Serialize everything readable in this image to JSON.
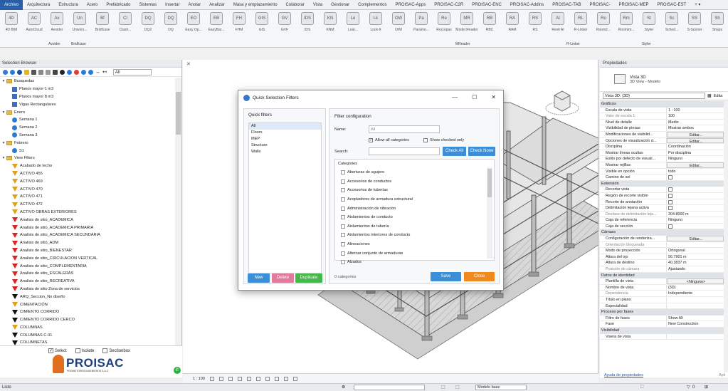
{
  "menubar": {
    "items": [
      "Archivo",
      "Arquitectura",
      "Estructura",
      "Acero",
      "Prefabricado",
      "Sistemas",
      "Insertar",
      "Anotar",
      "Analizar",
      "Masa y emplazamiento",
      "Colaborar",
      "Vista",
      "Gestionar",
      "Complementos",
      "PROISAC-Apps",
      "PROISAC-C2R",
      "PROISAC-ENC",
      "PROISAC-Addins",
      "PROISAC-TAB",
      "PROISAC-",
      "PROISAC-MEP",
      "PROISAC-EST"
    ],
    "extra": "+ ▾"
  },
  "ribbon": {
    "buttons": [
      {
        "label": "4D BIM",
        "icon": "4D"
      },
      {
        "label": "AutoCloud",
        "icon": "AC"
      },
      {
        "label": "Avoider",
        "icon": "Av"
      },
      {
        "label": "Univers...",
        "icon": "Un"
      },
      {
        "label": "Bridfcase",
        "icon": "Bf"
      },
      {
        "label": "Clash...",
        "icon": "Cl"
      },
      {
        "label": "DQ2",
        "icon": "DQ"
      },
      {
        "label": "DQ",
        "icon": "DQ"
      },
      {
        "label": "Easy Op...",
        "icon": "EO"
      },
      {
        "label": "EasyBar...",
        "icon": "EB"
      },
      {
        "label": "FHM",
        "icon": "FH"
      },
      {
        "label": "GIS",
        "icon": "GIS"
      },
      {
        "label": "GVF",
        "icon": "GV"
      },
      {
        "label": "IDS",
        "icon": "IDS"
      },
      {
        "label": "KNM",
        "icon": "KN"
      },
      {
        "label": "Lear...",
        "icon": "Le"
      },
      {
        "label": "Lock-It",
        "icon": "Lk"
      },
      {
        "label": "OWI",
        "icon": "OW"
      },
      {
        "label": "Parame...",
        "icon": "Pa"
      },
      {
        "label": "Recorpas",
        "icon": "Re"
      },
      {
        "label": "Model Reader",
        "icon": "MR"
      },
      {
        "label": "RBC",
        "icon": "RB"
      },
      {
        "label": "RAM",
        "icon": "RA"
      },
      {
        "label": "RS",
        "icon": "RS"
      },
      {
        "label": "Revit AI",
        "icon": "AI"
      },
      {
        "label": "R-Linker",
        "icon": "RL"
      },
      {
        "label": "Room2...",
        "icon": "Ro"
      },
      {
        "label": "Roomint...",
        "icon": "Rm"
      },
      {
        "label": "Styler",
        "icon": "St"
      },
      {
        "label": "Sched...",
        "icon": "Sc"
      },
      {
        "label": "S-Sooner",
        "icon": "SS"
      },
      {
        "label": "Shaps",
        "icon": "Sh"
      }
    ],
    "groups": [
      {
        "label": "Avoider"
      },
      {
        "label": "Bridfcase"
      },
      {
        "label": "MReader"
      },
      {
        "label": "R-Linker"
      },
      {
        "label": "Styler"
      }
    ]
  },
  "selection_browser": {
    "title": "Selection Browser",
    "filter_select": "All",
    "tree": [
      {
        "level": 0,
        "type": "folder",
        "label": "Busquedas",
        "twisty": "▼"
      },
      {
        "level": 1,
        "type": "blue",
        "label": "Planos mayor 1 m3"
      },
      {
        "level": 1,
        "type": "blue",
        "label": "Planos mayor 8 m3"
      },
      {
        "level": 1,
        "type": "blue",
        "label": "Vigas Rectangulares"
      },
      {
        "level": 0,
        "type": "folder",
        "label": "Enero",
        "twisty": "▼"
      },
      {
        "level": 1,
        "type": "circle",
        "label": "Semana 1"
      },
      {
        "level": 1,
        "type": "circle",
        "label": "Semana 2"
      },
      {
        "level": 1,
        "type": "circle",
        "label": "Semana 3"
      },
      {
        "level": 0,
        "type": "folder",
        "label": "Febrero",
        "twisty": "▼"
      },
      {
        "level": 1,
        "type": "circle",
        "label": "S1"
      },
      {
        "level": 0,
        "type": "folder",
        "label": "View Filters",
        "twisty": "▼"
      },
      {
        "level": 1,
        "type": "yellow",
        "label": "Acabado de techo"
      },
      {
        "level": 1,
        "type": "yellow",
        "label": "ACTIVO 455"
      },
      {
        "level": 1,
        "type": "yellow",
        "label": "ACTIVO 469"
      },
      {
        "level": 1,
        "type": "yellow",
        "label": "ACTIVO 470"
      },
      {
        "level": 1,
        "type": "yellow",
        "label": "ACTIVO 471"
      },
      {
        "level": 1,
        "type": "yellow",
        "label": "ACTIVO 472"
      },
      {
        "level": 1,
        "type": "yellow",
        "label": "ACTIVO OBRAS EXTERIORES"
      },
      {
        "level": 1,
        "type": "red",
        "label": "Analisis de sitio_ACADEMICA"
      },
      {
        "level": 1,
        "type": "red",
        "label": "Analisis de sitio_ACADEMICA PRIMARIA"
      },
      {
        "level": 1,
        "type": "red",
        "label": "Analisis de sitio_ACADEMICA SECUNDARIA"
      },
      {
        "level": 1,
        "type": "red",
        "label": "Analisis de sitio_ADM"
      },
      {
        "level": 1,
        "type": "red",
        "label": "Analisis de sitio_BIENESTAR"
      },
      {
        "level": 1,
        "type": "red",
        "label": "Analisis de sitio_CIRCULACION VERTICAL"
      },
      {
        "level": 1,
        "type": "red",
        "label": "Analisis de sitio_COMPLEMENTARIA"
      },
      {
        "level": 1,
        "type": "red",
        "label": "Analisis de sitio_ESCALERAS"
      },
      {
        "level": 1,
        "type": "red",
        "label": "Analisis de sitio_RECREATIVA"
      },
      {
        "level": 1,
        "type": "red",
        "label": "Analisis de sitio Zona de servicios"
      },
      {
        "level": 1,
        "type": "black",
        "label": "ARQ_Seccion_No diseño"
      },
      {
        "level": 1,
        "type": "yellow",
        "label": "CIMENTACIÓN"
      },
      {
        "level": 1,
        "type": "black",
        "label": "CIMIENTO CORRIDO"
      },
      {
        "level": 1,
        "type": "black",
        "label": "CIMIENTO CORRIDO CERCO"
      },
      {
        "level": 1,
        "type": "yellow",
        "label": "COLUMNAS"
      },
      {
        "level": 1,
        "type": "black",
        "label": "COLUMNAS C-01"
      },
      {
        "level": 1,
        "type": "black",
        "label": "COLUMNETAS"
      }
    ],
    "footer": {
      "select": "Select",
      "isolate": "Isolate",
      "sectionbox": "Sectionbox"
    },
    "logo": {
      "text": "PROISAC",
      "sub": "PROMOTORES INGENIEROS S.A.C."
    }
  },
  "dialog": {
    "title": "Quick Selection Filters",
    "quick_filters_title": "Quick filters",
    "quick_filters": [
      "All",
      "Floors",
      "MEP",
      "Structure",
      "Walls"
    ],
    "new_label": "New",
    "delete_label": "Delete",
    "duplicate_label": "Duplicate",
    "filter_config_title": "Filter configuration",
    "name_label": "Name:",
    "name_value": "All",
    "allow_all_label": "Allow all categories",
    "show_checked_label": "Show checked only",
    "search_label": "Search:",
    "check_all_label": "Check All",
    "check_none_label": "Check None",
    "categories_header": "Categories",
    "categories": [
      "Aberturas de agujero",
      "Accesorios de conductos",
      "Accesorios de tuberías",
      "Acopladores de armadura estructural",
      "Administración de vibración",
      "Aislamientos de conducto",
      "Aislamientos de tubería",
      "Aislamientos interiores de conducto",
      "Alineaciones",
      "Alternar conjunto de armaduras",
      "Alzados"
    ],
    "categories_count": "0 categories",
    "save_label": "Save",
    "close_label": "Close"
  },
  "properties": {
    "title": "Propiedades",
    "type_line1": "Vista 3D",
    "type_line2": "3D View - Modelo",
    "view_selector": "Vista 3D: {3D}",
    "edit_type": "Edita",
    "rows": [
      {
        "section": "Gráficos"
      },
      {
        "k": "Escala de vista",
        "v": "1 : 100"
      },
      {
        "k": "Valor de escala   1:",
        "v": "100",
        "dis": true
      },
      {
        "k": "Nivel de detalle",
        "v": "Medio"
      },
      {
        "k": "Visibilidad de piezas",
        "v": "Mostrar ambos"
      },
      {
        "k": "Modificaciones de visibilid...",
        "v": "Editar...",
        "btn": true
      },
      {
        "k": "Opciones de visualización d...",
        "v": "Editar...",
        "btn": true
      },
      {
        "k": "Disciplina",
        "v": "Coordinación"
      },
      {
        "k": "Mostrar líneas ocultas",
        "v": "Por disciplina"
      },
      {
        "k": "Estilo por defecto de visuali...",
        "v": "Ninguno"
      },
      {
        "k": "Mostrar rejillas",
        "v": "Editar...",
        "btn": true
      },
      {
        "k": "Visible en opción",
        "v": "todo"
      },
      {
        "k": "Camino de sol",
        "cb": true
      },
      {
        "section": "Extensión"
      },
      {
        "k": "Recortar vista",
        "cb": true
      },
      {
        "k": "Región de recorte visible",
        "cb": true
      },
      {
        "k": "Recorte de anotación",
        "cb": true
      },
      {
        "k": "Delimitación lejana activa",
        "cb": true
      },
      {
        "k": "Desfase de delimitación leja...",
        "v": "304.8000 m",
        "dis": true
      },
      {
        "k": "Caja de referencia",
        "v": "Ninguno"
      },
      {
        "k": "Caja de sección",
        "cb": true
      },
      {
        "section": "Cámara"
      },
      {
        "k": "Configuración de renderiza...",
        "v": "Editar...",
        "btn": true
      },
      {
        "k": "Orientación bloqueada",
        "dis": true
      },
      {
        "k": "Modo de proyección",
        "v": "Ortogonal"
      },
      {
        "k": "Altura del ojo",
        "v": "56.7901 m"
      },
      {
        "k": "Altura de destino",
        "v": "40.3837 m"
      },
      {
        "k": "Posición de cámara",
        "v": "Ajustando",
        "dis": true
      },
      {
        "section": "Datos de identidad"
      },
      {
        "k": "Plantilla de vista",
        "v": "<Ninguno>",
        "btn": true
      },
      {
        "k": "Nombre de vista",
        "v": "{3D}"
      },
      {
        "k": "Dependencia",
        "v": "Independiente",
        "dis": true
      },
      {
        "k": "Título en plano",
        "v": ""
      },
      {
        "k": "Especialidad",
        "v": ""
      },
      {
        "section": "Proceso por fases"
      },
      {
        "k": "Filtro de fases",
        "v": "Show All"
      },
      {
        "k": "Fase",
        "v": "New Construction"
      },
      {
        "section": "Visibilidad"
      },
      {
        "k": "Visera de vista",
        "v": ""
      }
    ],
    "help_link": "Ayuda de propiedades",
    "apply_label": "Apli"
  },
  "view_status": {
    "scale": "1 : 100"
  },
  "status_bar": {
    "left": "Listo",
    "model": "Modelo base",
    "zero": "0"
  }
}
